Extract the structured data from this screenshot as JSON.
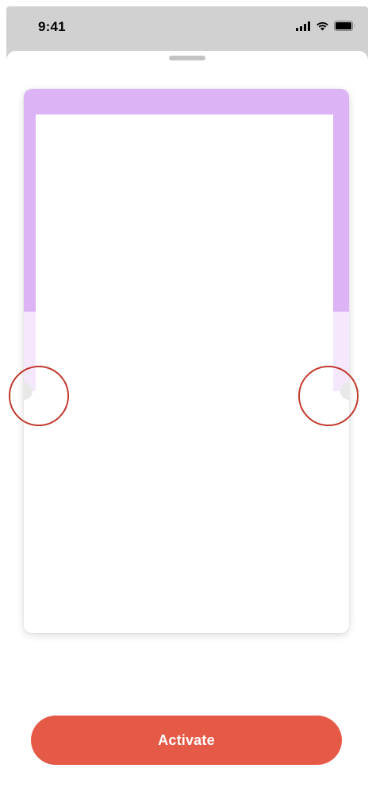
{
  "status_bar": {
    "time": "9:41",
    "icons": [
      "cellular-signal-icon",
      "wifi-icon",
      "battery-icon"
    ]
  },
  "sheet": {
    "grabber": "sheet-grabber"
  },
  "card": {
    "colors": {
      "header": "#dcb4f6",
      "tint": "#f5e8fd",
      "notch": "#e8e8e8",
      "highlight_ring": "#c0392b"
    }
  },
  "actions": {
    "activate_label": "Activate",
    "activate_color": "#e55a46"
  }
}
